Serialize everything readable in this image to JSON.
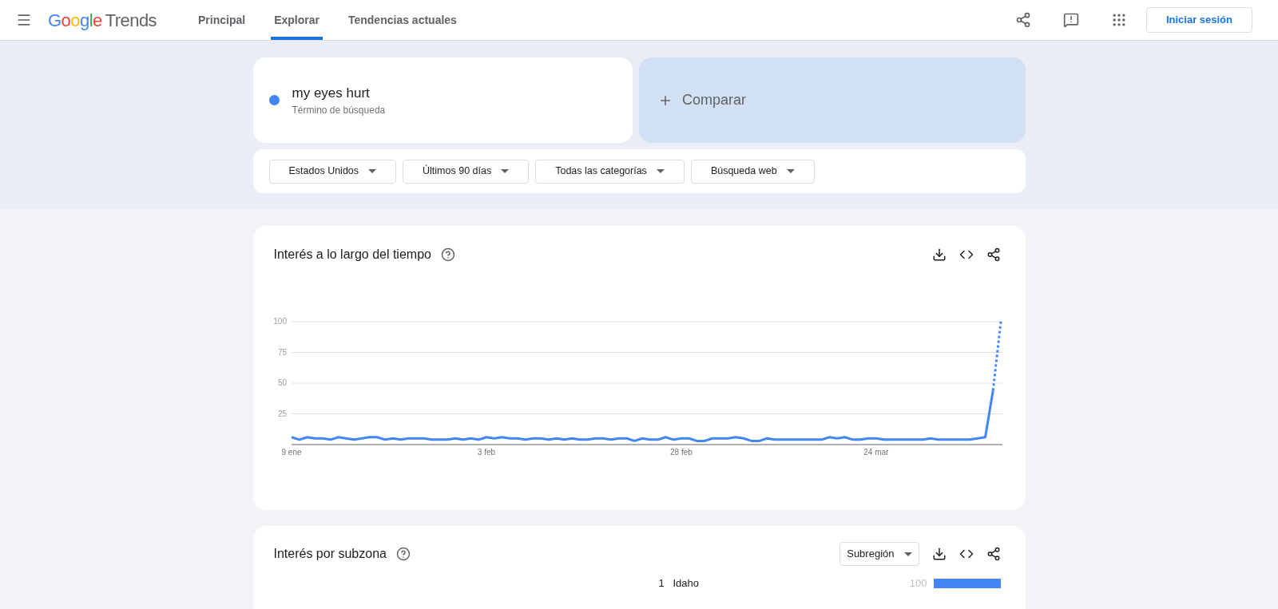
{
  "header": {
    "logo": {
      "brand": "Google",
      "product": "Trends"
    },
    "nav": [
      {
        "label": "Principal",
        "selected": false
      },
      {
        "label": "Explorar",
        "selected": true
      },
      {
        "label": "Tendencias actuales",
        "selected": false
      }
    ],
    "sign_in": "Iniciar sesión"
  },
  "search": {
    "term": "my eyes hurt",
    "subtitle": "Término de búsqueda",
    "color": "#4285f4",
    "compare": "Comparar"
  },
  "filters": [
    "Estados Unidos",
    "Últimos 90 días",
    "Todas las categorías",
    "Búsqueda web"
  ],
  "interest_over_time": {
    "title": "Interés a lo largo del tiempo",
    "chart_data": {
      "type": "line",
      "grid": true,
      "categories": [
        "9 ene",
        null,
        null,
        null,
        null,
        null,
        null,
        null,
        null,
        null,
        null,
        null,
        null,
        null,
        null,
        null,
        null,
        null,
        null,
        null,
        null,
        null,
        null,
        null,
        null,
        "3 feb",
        null,
        null,
        null,
        null,
        null,
        null,
        null,
        null,
        null,
        null,
        null,
        null,
        null,
        null,
        null,
        null,
        null,
        null,
        null,
        null,
        null,
        null,
        null,
        null,
        "28 feb",
        null,
        null,
        null,
        null,
        null,
        null,
        null,
        null,
        null,
        null,
        null,
        null,
        null,
        null,
        null,
        null,
        null,
        null,
        null,
        null,
        null,
        null,
        null,
        null,
        "24 mar",
        null,
        null,
        null,
        null,
        null,
        null,
        null,
        null,
        null,
        null,
        null,
        null,
        null,
        null,
        null,
        null
      ],
      "series": [
        {
          "color": "#4285f4",
          "line_style": "solid",
          "values": [
            6,
            4,
            6,
            5,
            5,
            4,
            6,
            5,
            4,
            5,
            6,
            6,
            4,
            5,
            4,
            5,
            5,
            5,
            4,
            4,
            4,
            5,
            4,
            5,
            4,
            6,
            5,
            6,
            5,
            5,
            4,
            5,
            5,
            4,
            5,
            4,
            5,
            4,
            4,
            5,
            5,
            4,
            5,
            5,
            3,
            5,
            4,
            4,
            6,
            4,
            5,
            5,
            3,
            3,
            5,
            5,
            5,
            6,
            5,
            3,
            3,
            5,
            4,
            4,
            4,
            4,
            4,
            4,
            4,
            6,
            5,
            6,
            4,
            4,
            5,
            5,
            4,
            4,
            4,
            4,
            4,
            4,
            5,
            4,
            4,
            4,
            4,
            4,
            5,
            6,
            44,
            null
          ]
        },
        {
          "color": "#4285f4",
          "line_style": "dotted",
          "values": [
            null,
            null,
            null,
            null,
            null,
            null,
            null,
            null,
            null,
            null,
            null,
            null,
            null,
            null,
            null,
            null,
            null,
            null,
            null,
            null,
            null,
            null,
            null,
            null,
            null,
            null,
            null,
            null,
            null,
            null,
            null,
            null,
            null,
            null,
            null,
            null,
            null,
            null,
            null,
            null,
            null,
            null,
            null,
            null,
            null,
            null,
            null,
            null,
            null,
            null,
            null,
            null,
            null,
            null,
            null,
            null,
            null,
            null,
            null,
            null,
            null,
            null,
            null,
            null,
            null,
            null,
            null,
            null,
            null,
            null,
            null,
            null,
            null,
            null,
            null,
            null,
            null,
            null,
            null,
            null,
            null,
            null,
            null,
            null,
            null,
            null,
            null,
            null,
            null,
            null,
            44,
            100
          ]
        }
      ],
      "ylim": [
        0,
        100
      ],
      "yticks": [
        25,
        50,
        75,
        100
      ]
    }
  },
  "interest_by_subregion": {
    "title": "Interés por subzona",
    "dropdown": "Subregión",
    "rows": [
      {
        "rank": "1",
        "name": "Idaho",
        "value": "100",
        "level": 1
      }
    ]
  }
}
